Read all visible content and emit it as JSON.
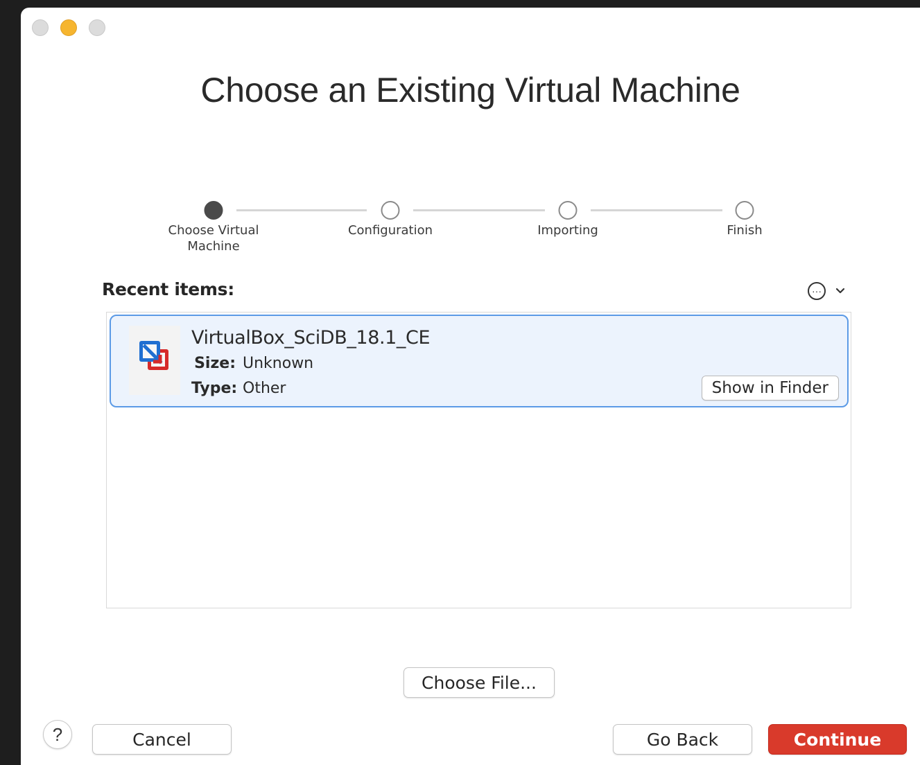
{
  "window": {
    "title": "Choose an Existing Virtual Machine"
  },
  "steps": [
    {
      "label": "Choose Virtual Machine",
      "active": true
    },
    {
      "label": "Configuration",
      "active": false
    },
    {
      "label": "Importing",
      "active": false
    },
    {
      "label": "Finish",
      "active": false
    }
  ],
  "recent": {
    "label": "Recent items:",
    "more_icon": "ellipsis-circle-icon",
    "dropdown_icon": "chevron-down-icon"
  },
  "items": [
    {
      "name": "VirtualBox_SciDB_18.1_CE",
      "icon": "vmware-fusion-vm-icon",
      "size_key": "Size:",
      "size_value": "Unknown",
      "type_key": "Type:",
      "type_value": "Other",
      "show_in_finder_label": "Show in Finder"
    }
  ],
  "buttons": {
    "choose_file": "Choose File...",
    "help": "?",
    "cancel": "Cancel",
    "go_back": "Go Back",
    "continue": "Continue"
  },
  "colors": {
    "accent": "#d93a2b",
    "selection_border": "#5b9ae6",
    "selection_fill": "#ecf3fd",
    "minimize": "#f6b52f"
  }
}
